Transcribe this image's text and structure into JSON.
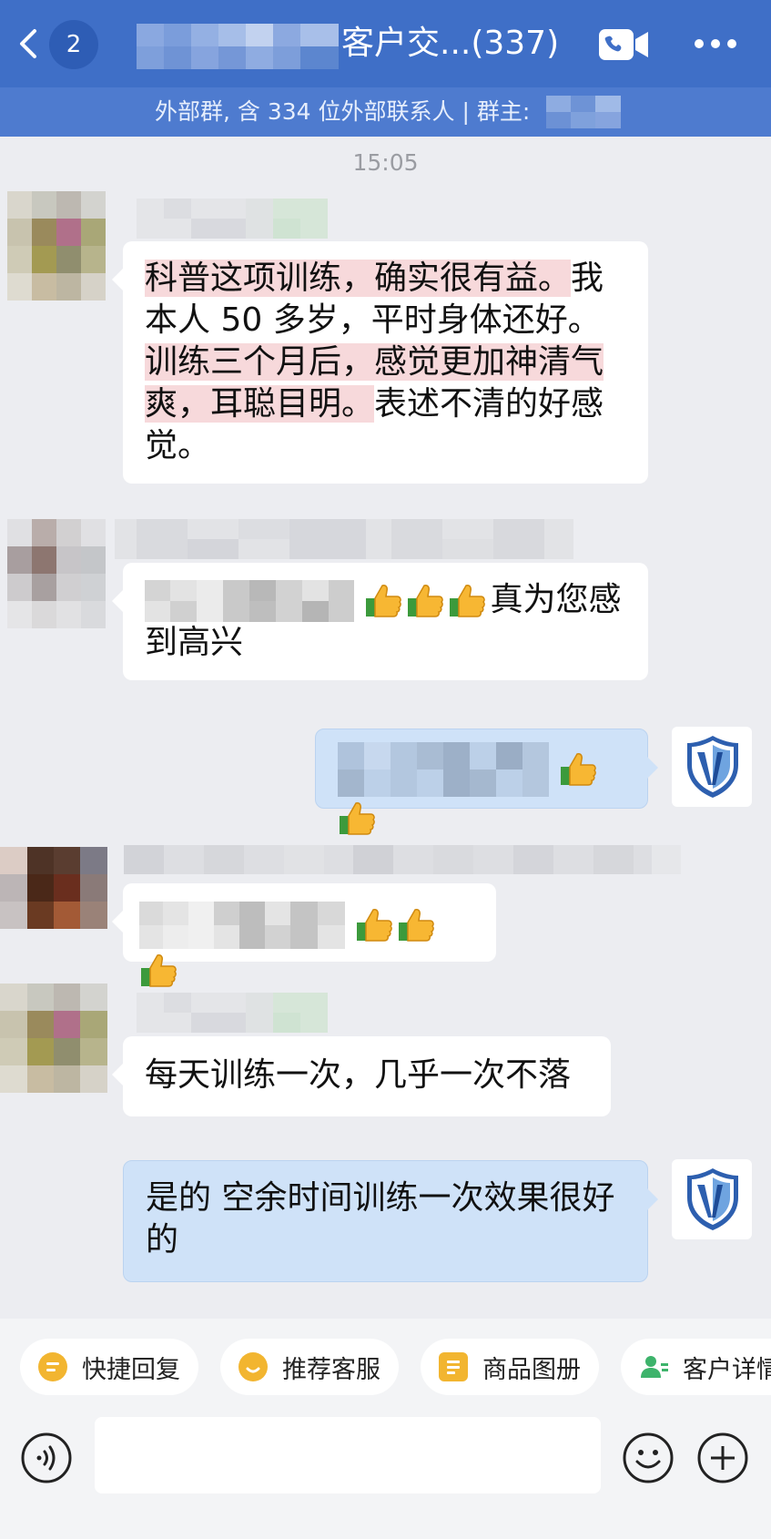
{
  "header": {
    "unread_count": "2",
    "title": "客户交...(337)",
    "subtitle": "外部群, 含 334 位外部联系人 | 群主:"
  },
  "chat": {
    "timestamp": "15:05",
    "messages": [
      {
        "sender": "other",
        "segments": [
          {
            "text": "科普这项训练，确实很有益。",
            "highlight": true
          },
          {
            "text": "我本人 50 多岁，平时身体还好。",
            "highlight": false
          },
          {
            "text": "训练三个月后，感觉更加神清气爽，耳聪目明。",
            "highlight": true
          },
          {
            "text": "表述不清的好感觉。",
            "highlight": false
          }
        ]
      },
      {
        "sender": "other",
        "text": "真为您感到高兴",
        "emoji": [
          "thumbs-up",
          "thumbs-up",
          "thumbs-up"
        ]
      },
      {
        "sender": "self",
        "emoji": [
          "thumbs-up",
          "thumbs-up"
        ]
      },
      {
        "sender": "other",
        "emoji": [
          "thumbs-up",
          "thumbs-up",
          "thumbs-up"
        ]
      },
      {
        "sender": "other",
        "text": "每天训练一次，几乎一次不落"
      },
      {
        "sender": "self",
        "text": "是的 空余时间训练一次效果很好的"
      }
    ]
  },
  "quick_actions": [
    {
      "label": "快捷回复",
      "icon": "quick-reply-icon",
      "color": "#F2B530"
    },
    {
      "label": "推荐客服",
      "icon": "recommend-service-icon",
      "color": "#F2B530"
    },
    {
      "label": "商品图册",
      "icon": "product-album-icon",
      "color": "#F2B530"
    },
    {
      "label": "客户详情",
      "icon": "customer-detail-icon",
      "color": "#3DB36B"
    }
  ],
  "colors": {
    "header_bg": "#3F6FC7",
    "subbar_bg": "#4E7BCF",
    "self_bubble": "#CFE2F8",
    "highlight": "#F7D9DB"
  }
}
